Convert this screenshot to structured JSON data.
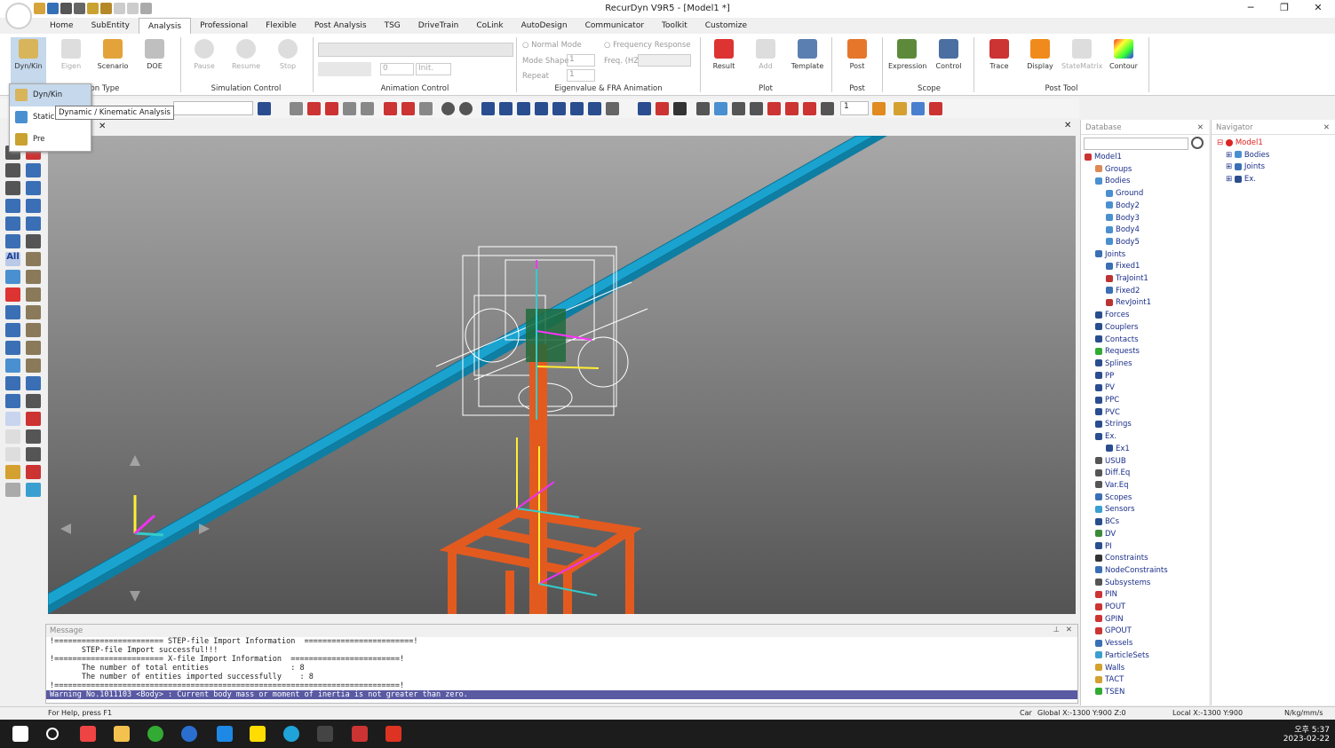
{
  "window": {
    "title": "RecurDyn V9R5  - [Model1 *]"
  },
  "ribbon_tabs": [
    "Home",
    "SubEntity",
    "Analysis",
    "Professional",
    "Flexible",
    "Post Analysis",
    "TSG",
    "DriveTrain",
    "CoLink",
    "AutoDesign",
    "Communicator",
    "Toolkit",
    "Customize"
  ],
  "ribbon": {
    "dynkin": "Dyn/Kin",
    "eigen": "Eigen",
    "scenario": "Scenario",
    "doe": "DOE",
    "pause": "Pause",
    "resume": "Resume",
    "stop": "Stop",
    "normal_mode": "Normal Mode",
    "freq_response": "Frequency Response",
    "mode_shape": "Mode Shape",
    "mode_shape_val": "1",
    "repeat": "Repeat",
    "repeat_val": "1",
    "freq_hz": "Freq. (HZ)",
    "anim_val": "0",
    "init": "Init.",
    "result": "Result",
    "add": "Add",
    "template": "Template",
    "post": "Post",
    "expression": "Expression",
    "control": "Control",
    "trace": "Trace",
    "display": "Display",
    "statematrix": "StateMatrix",
    "contour": "Contour",
    "groups": {
      "analysis_type": "on Type",
      "simulation_control": "Simulation Control",
      "animation_control": "Animation Control",
      "eigen_fra": "Eigenvalue & FRA Animation",
      "plot": "Plot",
      "post": "Post",
      "scope": "Scope",
      "post_tool": "Post Tool"
    }
  },
  "toolbar2": {
    "layer_val": "1"
  },
  "dropdown": {
    "items": [
      "Dyn/Kin",
      "Static",
      "Pre"
    ]
  },
  "tooltip": "Dynamic / Kinematic Analysis",
  "left_toolbar": {
    "all_label": "All"
  },
  "database": {
    "title": "Database",
    "items": [
      "Model1",
      "Groups",
      "Bodies",
      "Ground",
      "Body2",
      "Body3",
      "Body4",
      "Body5",
      "Joints",
      "Fixed1",
      "TraJoint1",
      "Fixed2",
      "RevJoint1",
      "Forces",
      "Couplers",
      "Contacts",
      "Requests",
      "Splines",
      "PP",
      "PV",
      "PPC",
      "PVC",
      "Strings",
      "Ex.",
      "Ex1",
      "USUB",
      "Diff.Eq",
      "Var.Eq",
      "Scopes",
      "Sensors",
      "BCs",
      "DV",
      "PI",
      "Constraints",
      "NodeConstraints",
      "Subsystems",
      "PIN",
      "POUT",
      "GPIN",
      "GPOUT",
      "Vessels",
      "ParticleSets",
      "Walls",
      "TACT",
      "TSEN"
    ]
  },
  "navigator": {
    "title": "Navigator",
    "items": [
      "Model1",
      "Bodies",
      "Joints",
      "Ex."
    ]
  },
  "message": {
    "title": "Message",
    "lines": [
      "!======================== STEP-file Import Information  ========================!",
      "       STEP-file Import successful!!!",
      "!======================== X-file Import Information  ========================!",
      "       The number of total entities                  : 8",
      "       The number of entities imported successfully    : 8",
      "!============================================================================!"
    ],
    "warning": "Warning No.1011103 <Body> : Current body mass or moment of inertia is not greater than zero."
  },
  "status": {
    "help": "For Help, press F1",
    "car": "Car",
    "global": "Global  X:-1300 Y:900 Z:0",
    "local": "Local   X:-1300 Y:900",
    "units": "N/kg/mm/s"
  },
  "taskbar": {
    "time": "오후 5:37",
    "date": "2023-02-22"
  },
  "colors": {
    "accent": "#c5d8ec",
    "beam": "#1aa3cf",
    "frame": "#e35a1f",
    "wire": "#ffffff",
    "warning": "#5a5aa3"
  }
}
